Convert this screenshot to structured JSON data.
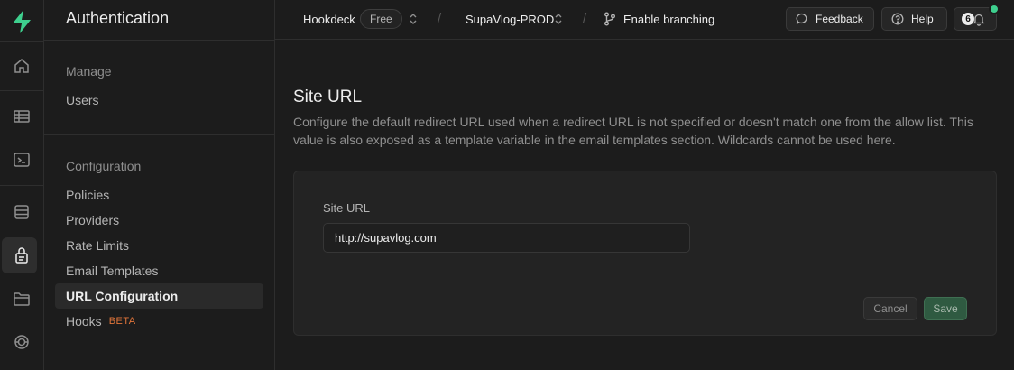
{
  "app": {
    "section_title": "Authentication"
  },
  "topbar": {
    "org_name": "Hookdeck",
    "plan_badge": "Free",
    "project_name": "SupaVlog-PROD",
    "branching_label": "Enable branching",
    "feedback_label": "Feedback",
    "help_label": "Help",
    "notification_count": "6"
  },
  "menu": {
    "manage_heading": "Manage",
    "manage_items": [
      {
        "label": "Users"
      }
    ],
    "configuration_heading": "Configuration",
    "configuration_items": [
      {
        "label": "Policies"
      },
      {
        "label": "Providers"
      },
      {
        "label": "Rate Limits"
      },
      {
        "label": "Email Templates"
      },
      {
        "label": "URL Configuration",
        "active": true
      },
      {
        "label": "Hooks",
        "badge": "BETA"
      }
    ]
  },
  "rail": {
    "icons": [
      "home-icon",
      "table-editor-icon",
      "sql-editor-icon",
      "database-icon",
      "auth-icon",
      "storage-icon",
      "realtime-icon"
    ],
    "active": "auth-icon"
  },
  "main": {
    "title": "Site URL",
    "description": "Configure the default redirect URL used when a redirect URL is not specified or doesn't match one from the allow list. This value is also exposed as a template variable in the email templates section. Wildcards cannot be used here.",
    "form": {
      "field_label": "Site URL",
      "field_value": "http://supavlog.com",
      "cancel_label": "Cancel",
      "save_label": "Save"
    }
  },
  "colors": {
    "brand": "#3ecf8e",
    "beta": "#e2753a",
    "save_button": "#2f5a41"
  }
}
